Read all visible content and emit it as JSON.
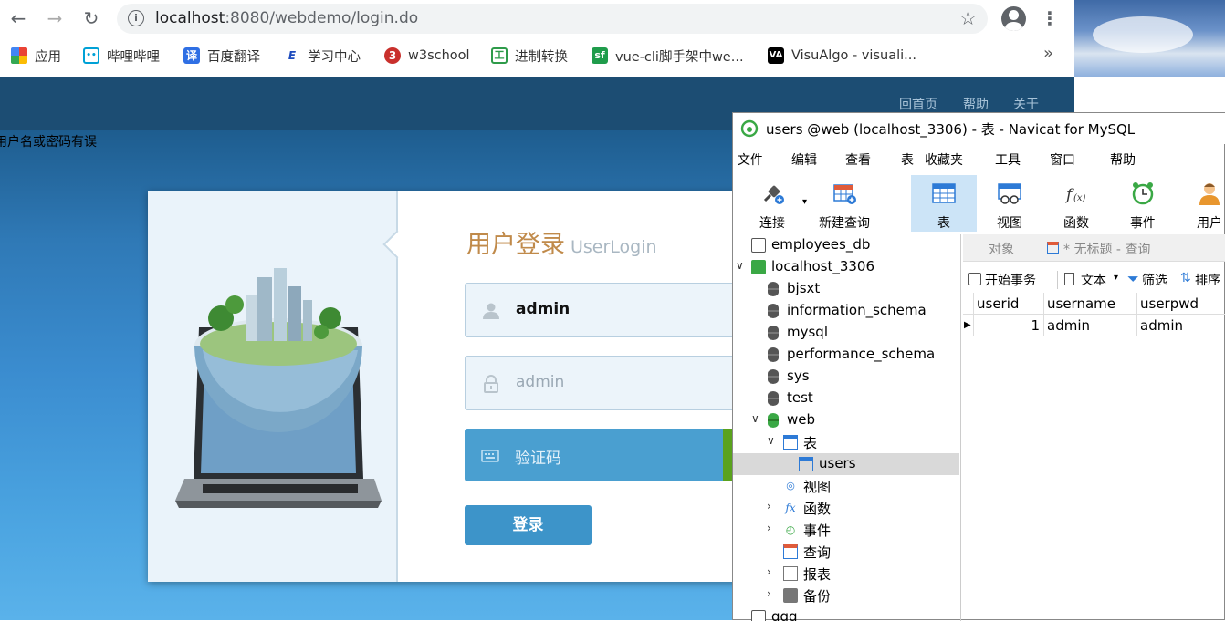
{
  "browser": {
    "url_host": "localhost",
    "url_rest": ":8080/webdemo/login.do",
    "bookmarks": [
      {
        "label": "应用",
        "icon": "apps-grid-icon"
      },
      {
        "label": "哔哩哔哩",
        "icon": "bilibili-icon"
      },
      {
        "label": "百度翻译",
        "icon": "translate-icon"
      },
      {
        "label": "学习中心",
        "icon": "learning-icon"
      },
      {
        "label": "w3school",
        "icon": "w3school-icon"
      },
      {
        "label": "进制转换",
        "icon": "converter-icon"
      },
      {
        "label": "vue-cli脚手架中we...",
        "icon": "sf-icon"
      },
      {
        "label": "VisuAlgo - visuali...",
        "icon": "visualgo-icon"
      }
    ],
    "more": "»"
  },
  "page": {
    "nav": [
      "回首页",
      "帮助",
      "关于"
    ],
    "error": "用户名或密码有误",
    "login_title": "用户登录",
    "login_title_en": "UserLogin",
    "username_value": "admin",
    "password_placeholder": "admin",
    "captcha_placeholder": "验证码",
    "login_button": "登录"
  },
  "navicat": {
    "title": "users @web (localhost_3306) - 表 - Navicat for MySQL",
    "menu": [
      "文件",
      "编辑",
      "查看",
      "表",
      "收藏夹",
      "工具",
      "窗口",
      "帮助"
    ],
    "tools": [
      "连接",
      "新建查询",
      "表",
      "视图",
      "函数",
      "事件",
      "用户"
    ],
    "tree": {
      "employees_db": "employees_db",
      "localhost": "localhost_3306",
      "dbs": [
        "bjsxt",
        "information_schema",
        "mysql",
        "performance_schema",
        "sys",
        "test",
        "web"
      ],
      "tables_node": "表",
      "users": "users",
      "views": "视图",
      "functions": "函数",
      "events": "事件",
      "queries": "查询",
      "reports": "报表",
      "backups": "备份",
      "qqq": "qqq"
    },
    "tabs": {
      "objects": "对象",
      "query": "* 无标题 - 查询"
    },
    "query_toolbar": {
      "begin": "开始事务",
      "text": "文本",
      "filter": "筛选",
      "sort": "排序"
    },
    "grid": {
      "columns": [
        "userid",
        "username",
        "userpwd"
      ],
      "rows": [
        [
          "1",
          "admin",
          "admin"
        ]
      ]
    }
  }
}
